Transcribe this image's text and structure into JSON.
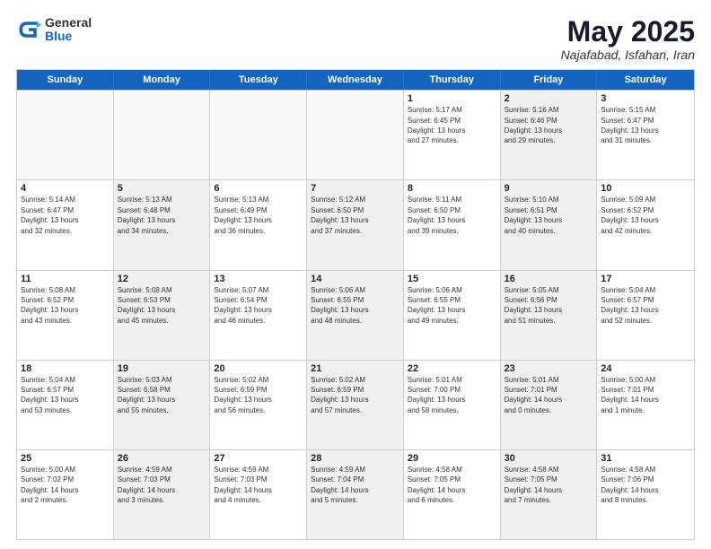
{
  "logo": {
    "general": "General",
    "blue": "Blue"
  },
  "header": {
    "month": "May 2025",
    "location": "Najafabad, Isfahan, Iran"
  },
  "weekdays": [
    "Sunday",
    "Monday",
    "Tuesday",
    "Wednesday",
    "Thursday",
    "Friday",
    "Saturday"
  ],
  "rows": [
    [
      {
        "day": "",
        "lines": [],
        "empty": true
      },
      {
        "day": "",
        "lines": [],
        "empty": true
      },
      {
        "day": "",
        "lines": [],
        "empty": true
      },
      {
        "day": "",
        "lines": [],
        "empty": true
      },
      {
        "day": "1",
        "lines": [
          "Sunrise: 5:17 AM",
          "Sunset: 6:45 PM",
          "Daylight: 13 hours",
          "and 27 minutes."
        ]
      },
      {
        "day": "2",
        "lines": [
          "Sunrise: 5:16 AM",
          "Sunset: 6:46 PM",
          "Daylight: 13 hours",
          "and 29 minutes."
        ],
        "shaded": true
      },
      {
        "day": "3",
        "lines": [
          "Sunrise: 5:15 AM",
          "Sunset: 6:47 PM",
          "Daylight: 13 hours",
          "and 31 minutes."
        ]
      }
    ],
    [
      {
        "day": "4",
        "lines": [
          "Sunrise: 5:14 AM",
          "Sunset: 6:47 PM",
          "Daylight: 13 hours",
          "and 32 minutes."
        ]
      },
      {
        "day": "5",
        "lines": [
          "Sunrise: 5:13 AM",
          "Sunset: 6:48 PM",
          "Daylight: 13 hours",
          "and 34 minutes."
        ],
        "shaded": true
      },
      {
        "day": "6",
        "lines": [
          "Sunrise: 5:13 AM",
          "Sunset: 6:49 PM",
          "Daylight: 13 hours",
          "and 36 minutes."
        ]
      },
      {
        "day": "7",
        "lines": [
          "Sunrise: 5:12 AM",
          "Sunset: 6:50 PM",
          "Daylight: 13 hours",
          "and 37 minutes."
        ],
        "shaded": true
      },
      {
        "day": "8",
        "lines": [
          "Sunrise: 5:11 AM",
          "Sunset: 6:50 PM",
          "Daylight: 13 hours",
          "and 39 minutes."
        ]
      },
      {
        "day": "9",
        "lines": [
          "Sunrise: 5:10 AM",
          "Sunset: 6:51 PM",
          "Daylight: 13 hours",
          "and 40 minutes."
        ],
        "shaded": true
      },
      {
        "day": "10",
        "lines": [
          "Sunrise: 5:09 AM",
          "Sunset: 6:52 PM",
          "Daylight: 13 hours",
          "and 42 minutes."
        ]
      }
    ],
    [
      {
        "day": "11",
        "lines": [
          "Sunrise: 5:08 AM",
          "Sunset: 6:52 PM",
          "Daylight: 13 hours",
          "and 43 minutes."
        ]
      },
      {
        "day": "12",
        "lines": [
          "Sunrise: 5:08 AM",
          "Sunset: 6:53 PM",
          "Daylight: 13 hours",
          "and 45 minutes."
        ],
        "shaded": true
      },
      {
        "day": "13",
        "lines": [
          "Sunrise: 5:07 AM",
          "Sunset: 6:54 PM",
          "Daylight: 13 hours",
          "and 46 minutes."
        ]
      },
      {
        "day": "14",
        "lines": [
          "Sunrise: 5:06 AM",
          "Sunset: 6:55 PM",
          "Daylight: 13 hours",
          "and 48 minutes."
        ],
        "shaded": true
      },
      {
        "day": "15",
        "lines": [
          "Sunrise: 5:06 AM",
          "Sunset: 6:55 PM",
          "Daylight: 13 hours",
          "and 49 minutes."
        ]
      },
      {
        "day": "16",
        "lines": [
          "Sunrise: 5:05 AM",
          "Sunset: 6:56 PM",
          "Daylight: 13 hours",
          "and 51 minutes."
        ],
        "shaded": true
      },
      {
        "day": "17",
        "lines": [
          "Sunrise: 5:04 AM",
          "Sunset: 6:57 PM",
          "Daylight: 13 hours",
          "and 52 minutes."
        ]
      }
    ],
    [
      {
        "day": "18",
        "lines": [
          "Sunrise: 5:04 AM",
          "Sunset: 6:57 PM",
          "Daylight: 13 hours",
          "and 53 minutes."
        ]
      },
      {
        "day": "19",
        "lines": [
          "Sunrise: 5:03 AM",
          "Sunset: 6:58 PM",
          "Daylight: 13 hours",
          "and 55 minutes."
        ],
        "shaded": true
      },
      {
        "day": "20",
        "lines": [
          "Sunrise: 5:02 AM",
          "Sunset: 6:59 PM",
          "Daylight: 13 hours",
          "and 56 minutes."
        ]
      },
      {
        "day": "21",
        "lines": [
          "Sunrise: 5:02 AM",
          "Sunset: 6:59 PM",
          "Daylight: 13 hours",
          "and 57 minutes."
        ],
        "shaded": true
      },
      {
        "day": "22",
        "lines": [
          "Sunrise: 5:01 AM",
          "Sunset: 7:00 PM",
          "Daylight: 13 hours",
          "and 58 minutes."
        ]
      },
      {
        "day": "23",
        "lines": [
          "Sunrise: 5:01 AM",
          "Sunset: 7:01 PM",
          "Daylight: 14 hours",
          "and 0 minutes."
        ],
        "shaded": true
      },
      {
        "day": "24",
        "lines": [
          "Sunrise: 5:00 AM",
          "Sunset: 7:01 PM",
          "Daylight: 14 hours",
          "and 1 minute."
        ]
      }
    ],
    [
      {
        "day": "25",
        "lines": [
          "Sunrise: 5:00 AM",
          "Sunset: 7:02 PM",
          "Daylight: 14 hours",
          "and 2 minutes."
        ]
      },
      {
        "day": "26",
        "lines": [
          "Sunrise: 4:59 AM",
          "Sunset: 7:03 PM",
          "Daylight: 14 hours",
          "and 3 minutes."
        ],
        "shaded": true
      },
      {
        "day": "27",
        "lines": [
          "Sunrise: 4:59 AM",
          "Sunset: 7:03 PM",
          "Daylight: 14 hours",
          "and 4 minutes."
        ]
      },
      {
        "day": "28",
        "lines": [
          "Sunrise: 4:59 AM",
          "Sunset: 7:04 PM",
          "Daylight: 14 hours",
          "and 5 minutes."
        ],
        "shaded": true
      },
      {
        "day": "29",
        "lines": [
          "Sunrise: 4:58 AM",
          "Sunset: 7:05 PM",
          "Daylight: 14 hours",
          "and 6 minutes."
        ]
      },
      {
        "day": "30",
        "lines": [
          "Sunrise: 4:58 AM",
          "Sunset: 7:05 PM",
          "Daylight: 14 hours",
          "and 7 minutes."
        ],
        "shaded": true
      },
      {
        "day": "31",
        "lines": [
          "Sunrise: 4:58 AM",
          "Sunset: 7:06 PM",
          "Daylight: 14 hours",
          "and 8 minutes."
        ]
      }
    ]
  ]
}
